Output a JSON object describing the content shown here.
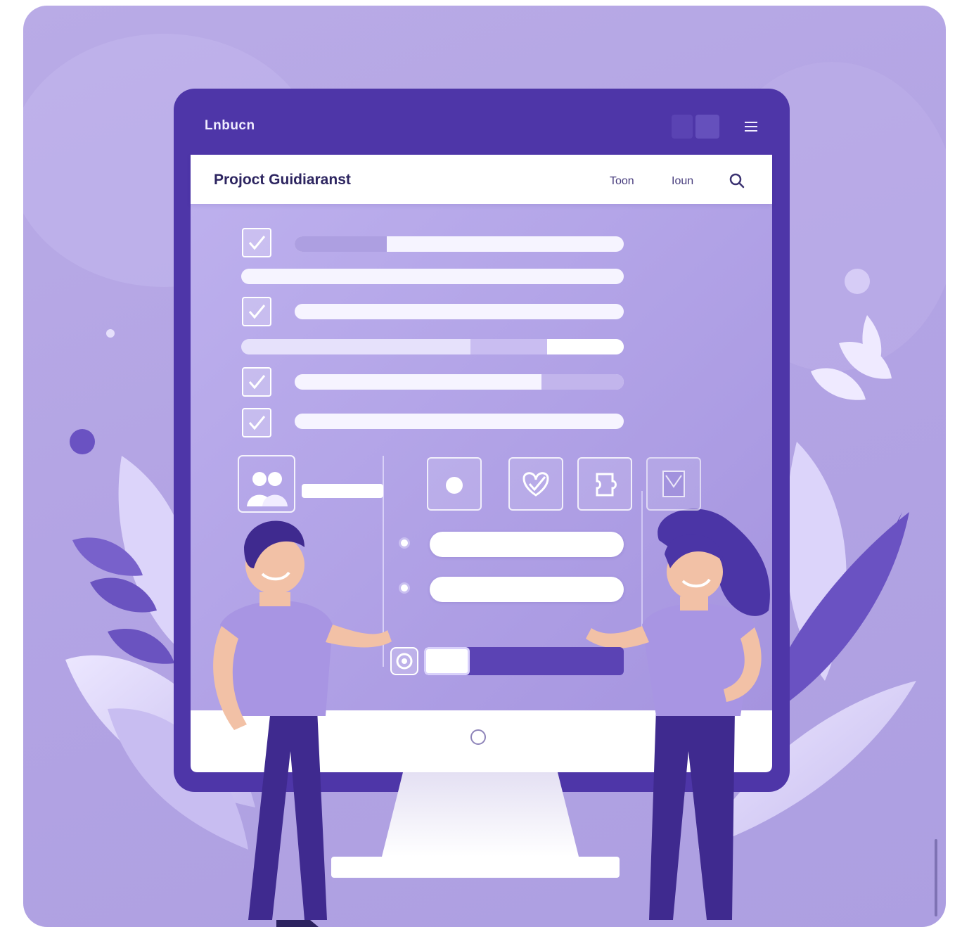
{
  "app": {
    "brand": "Lnbucn"
  },
  "header": {
    "title": "Projoct Guidiaranst",
    "nav": [
      "Toon",
      "Ioun"
    ],
    "search_icon": "search-icon",
    "menu_icon": "menu-icon"
  },
  "tasks": [
    {
      "checked": true,
      "progress": 0.28
    },
    {
      "checked": false,
      "progress": 0.0
    },
    {
      "checked": true,
      "progress": 0.0
    },
    {
      "checked": false,
      "progress": 0.25
    },
    {
      "checked": true,
      "progress": 0.25
    },
    {
      "checked": true,
      "progress": 0.0
    }
  ],
  "tiles": [
    "circle-icon",
    "heart-check-icon",
    "puzzle-icon",
    "document-icon"
  ],
  "team_icon": "team-icon",
  "form": {
    "radio_count": 2,
    "progress": 0.35
  },
  "colors": {
    "background": "#b6a8e4",
    "monitor_frame": "#4e36a8",
    "screen": "#ad9fe1",
    "accent": "#5b43b4",
    "figure_shirt": "#a895e3",
    "figure_pants": "#3f2a8f"
  }
}
